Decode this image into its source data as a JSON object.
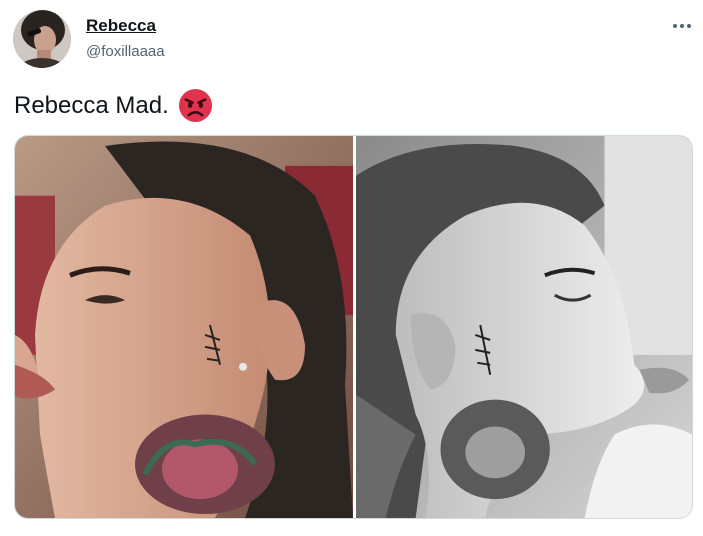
{
  "author": {
    "display_name": "Rebecca",
    "handle": "@foxillaaaa"
  },
  "menu": {
    "icon": "more-horizontal-icon"
  },
  "tweet": {
    "text": "Rebecca Mad.",
    "emoji": "pouting-face-emoji"
  },
  "media": {
    "photos": [
      {
        "name": "left-photo",
        "style": "color"
      },
      {
        "name": "right-photo",
        "style": "grayscale"
      }
    ]
  },
  "colors": {
    "text": "#0f1419",
    "secondary_text": "#536471",
    "border": "#cfd9de",
    "emoji_red": "#e0334d"
  }
}
